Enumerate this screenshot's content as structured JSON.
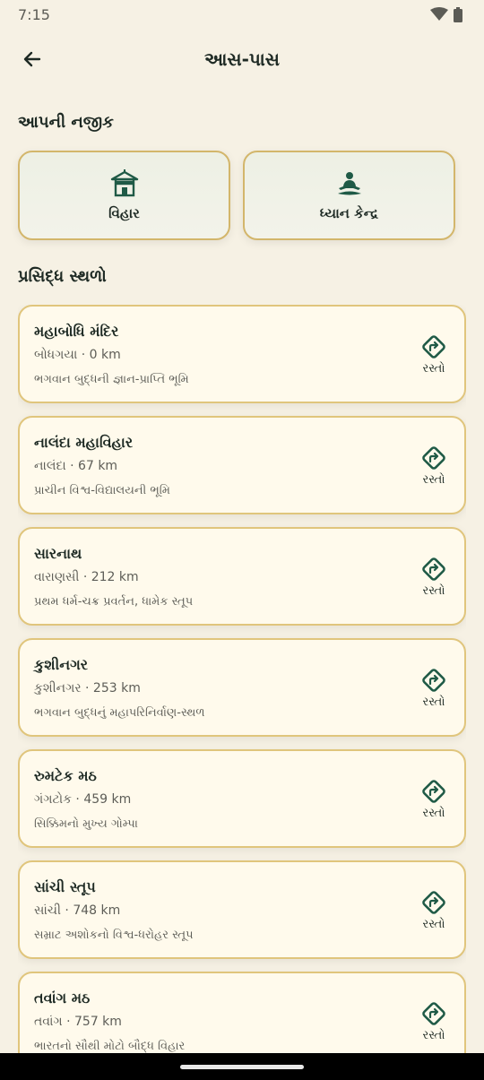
{
  "status": {
    "time": "7:15"
  },
  "appbar": {
    "title": "આસ-પાસ"
  },
  "near": {
    "heading": "આપની નજીક",
    "items": [
      {
        "label": "વિહાર",
        "icon": "temple-icon"
      },
      {
        "label": "ધ્યાન કેન્દ્ર",
        "icon": "meditation-icon"
      }
    ]
  },
  "famous": {
    "heading": "પ્રસિદ્ધ સ્થળો",
    "route_label": "રસ્તો",
    "places": [
      {
        "name": "મહાબોધિ મંદિર",
        "distance": "બોધગયા · 0 km",
        "desc": "ભગવાન બુદ્ધની જ્ઞાન-પ્રાપ્તિ ભૂમિ"
      },
      {
        "name": "નાલંદા મહાવિહાર",
        "distance": "નાલંદા · 67 km",
        "desc": "પ્રાચીન વિશ્વ-વિદ્યાલયની ભૂમિ"
      },
      {
        "name": "સારનાથ",
        "distance": "વારાણસી · 212 km",
        "desc": "પ્રથમ ધર્મ-ચક્ર પ્રવર્તન, ધામેક સ્તૂપ"
      },
      {
        "name": "કુશીનગર",
        "distance": "કુશીનગર · 253 km",
        "desc": "ભગવાન બુદ્ધનું મહાપરિનિર્વાણ-સ્થળ"
      },
      {
        "name": "રુમટેક મઠ",
        "distance": "ગંગટોક · 459 km",
        "desc": "સિક્કિમનો મુખ્ય ગોમ્પા"
      },
      {
        "name": "સાંચી સ્તૂપ",
        "distance": "સાંચી · 748 km",
        "desc": "સમ્રાટ અશોકનો વિશ્વ-ધરોહર સ્તૂપ"
      },
      {
        "name": "તવાંગ મઠ",
        "distance": "તવાંગ · 757 km",
        "desc": "ભારતનો સૌથી મોટો બૌદ્ધ વિહાર"
      }
    ]
  },
  "colors": {
    "accent": "#1f5a46",
    "card_border": "#e0c57c",
    "background": "#f6f1e4"
  }
}
